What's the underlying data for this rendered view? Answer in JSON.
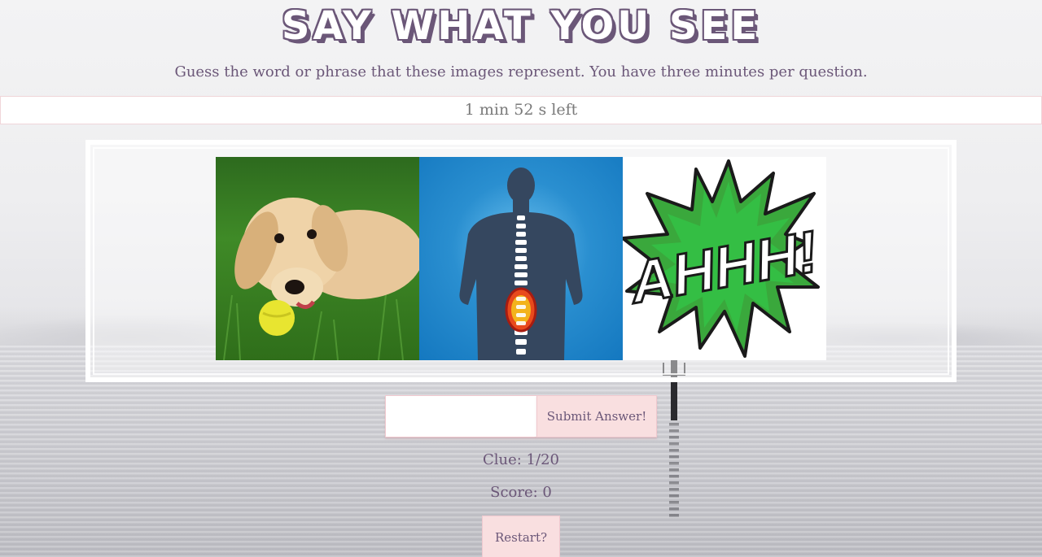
{
  "header": {
    "title": "SAY WHAT YOU SEE",
    "subtitle": "Guess the word or phrase that these images represent. You have three minutes per question."
  },
  "timer": {
    "text": "1 min 52 s left"
  },
  "clue_images": [
    {
      "icon": "puppy-with-ball-icon"
    },
    {
      "icon": "spine-back-pain-icon"
    },
    {
      "icon": "ahhh-exclamation-icon",
      "text": "AHHH!"
    }
  ],
  "answer": {
    "value": "",
    "placeholder": "",
    "submit_label": "Submit Answer!"
  },
  "stats": {
    "clue": "Clue: 1/20",
    "score": "Score: 0"
  },
  "restart_label": "Restart?",
  "colors": {
    "accent": "#6b5778",
    "button_bg": "#f9dfe0",
    "button_border": "#f0c9cf"
  }
}
